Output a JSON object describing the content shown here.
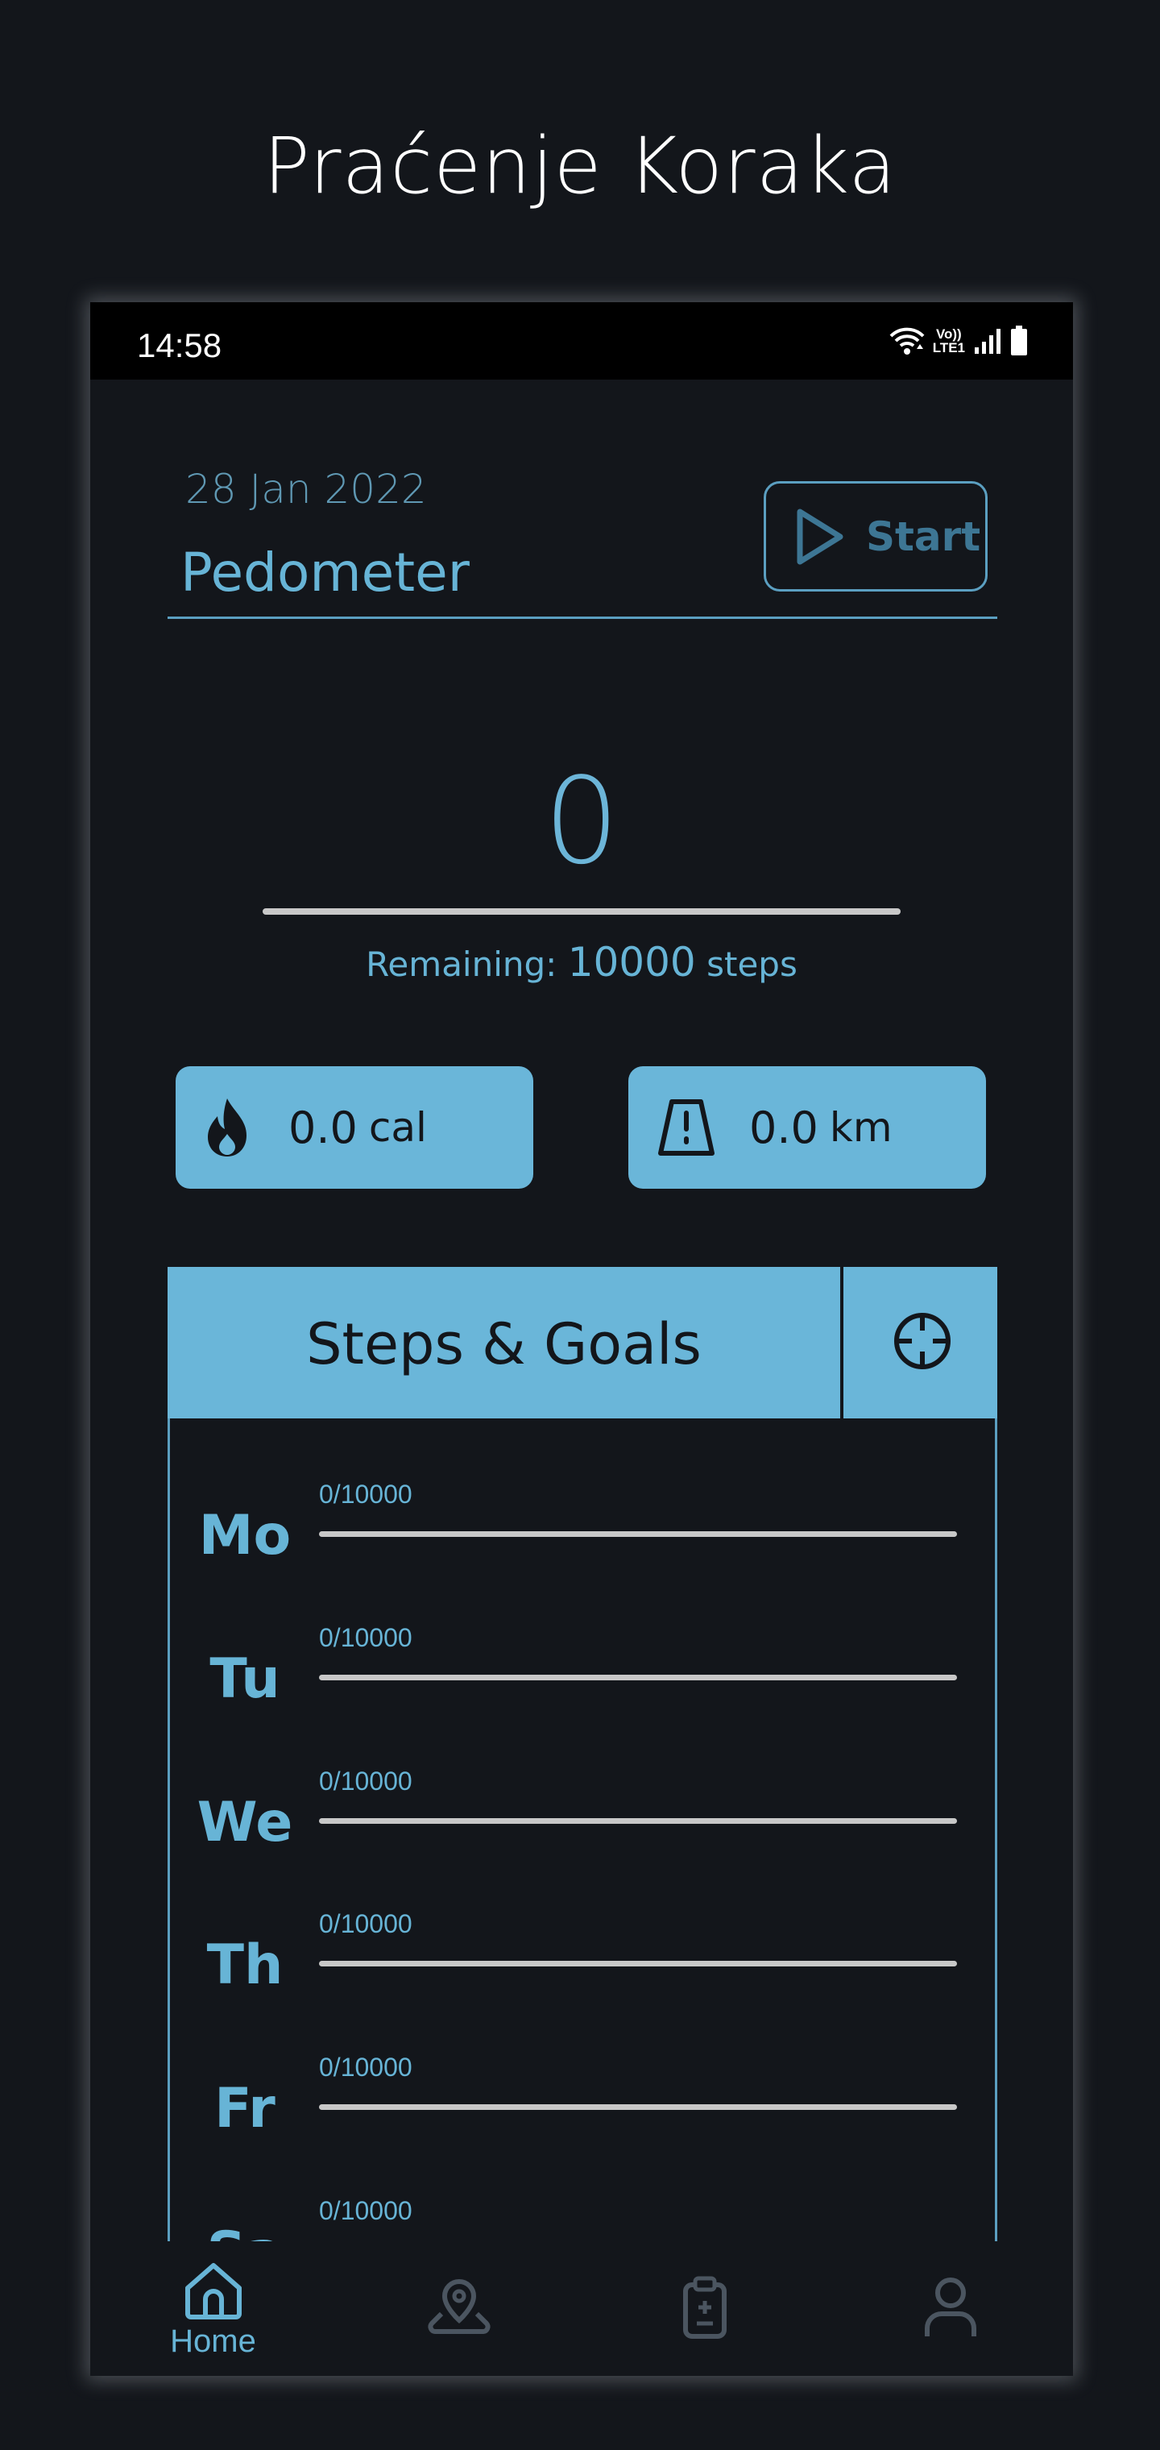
{
  "page_title": "Praćenje Koraka",
  "status_bar": {
    "time": "14:58",
    "volte_top": "Vo))",
    "volte_bottom": "LTE1"
  },
  "header": {
    "date": "28 Jan 2022",
    "title": "Pedometer",
    "start_label": "Start"
  },
  "steps": {
    "count": "0",
    "progress_fraction": 0,
    "remaining_prefix": "Remaining:",
    "remaining_value": "10000",
    "remaining_suffix": "steps"
  },
  "stats": {
    "calories_value": "0.0",
    "calories_unit": "cal",
    "distance_value": "0.0",
    "distance_unit": "km"
  },
  "goals": {
    "title": "Steps & Goals",
    "days": [
      {
        "label": "Mo",
        "value": "0/10000",
        "fraction": 0
      },
      {
        "label": "Tu",
        "value": "0/10000",
        "fraction": 0
      },
      {
        "label": "We",
        "value": "0/10000",
        "fraction": 0
      },
      {
        "label": "Th",
        "value": "0/10000",
        "fraction": 0
      },
      {
        "label": "Fr",
        "value": "0/10000",
        "fraction": 0
      },
      {
        "label": "Sa",
        "value": "0/10000",
        "fraction": 0
      }
    ]
  },
  "nav": {
    "items": [
      {
        "label": "Home",
        "icon": "home-icon",
        "active": true
      },
      {
        "label": "",
        "icon": "map-pin-icon",
        "active": false
      },
      {
        "label": "",
        "icon": "clipboard-icon",
        "active": false
      },
      {
        "label": "",
        "icon": "profile-icon",
        "active": false
      }
    ]
  },
  "colors": {
    "accent": "#67b4d6",
    "background": "#13161b",
    "inactive": "#4b5560"
  }
}
